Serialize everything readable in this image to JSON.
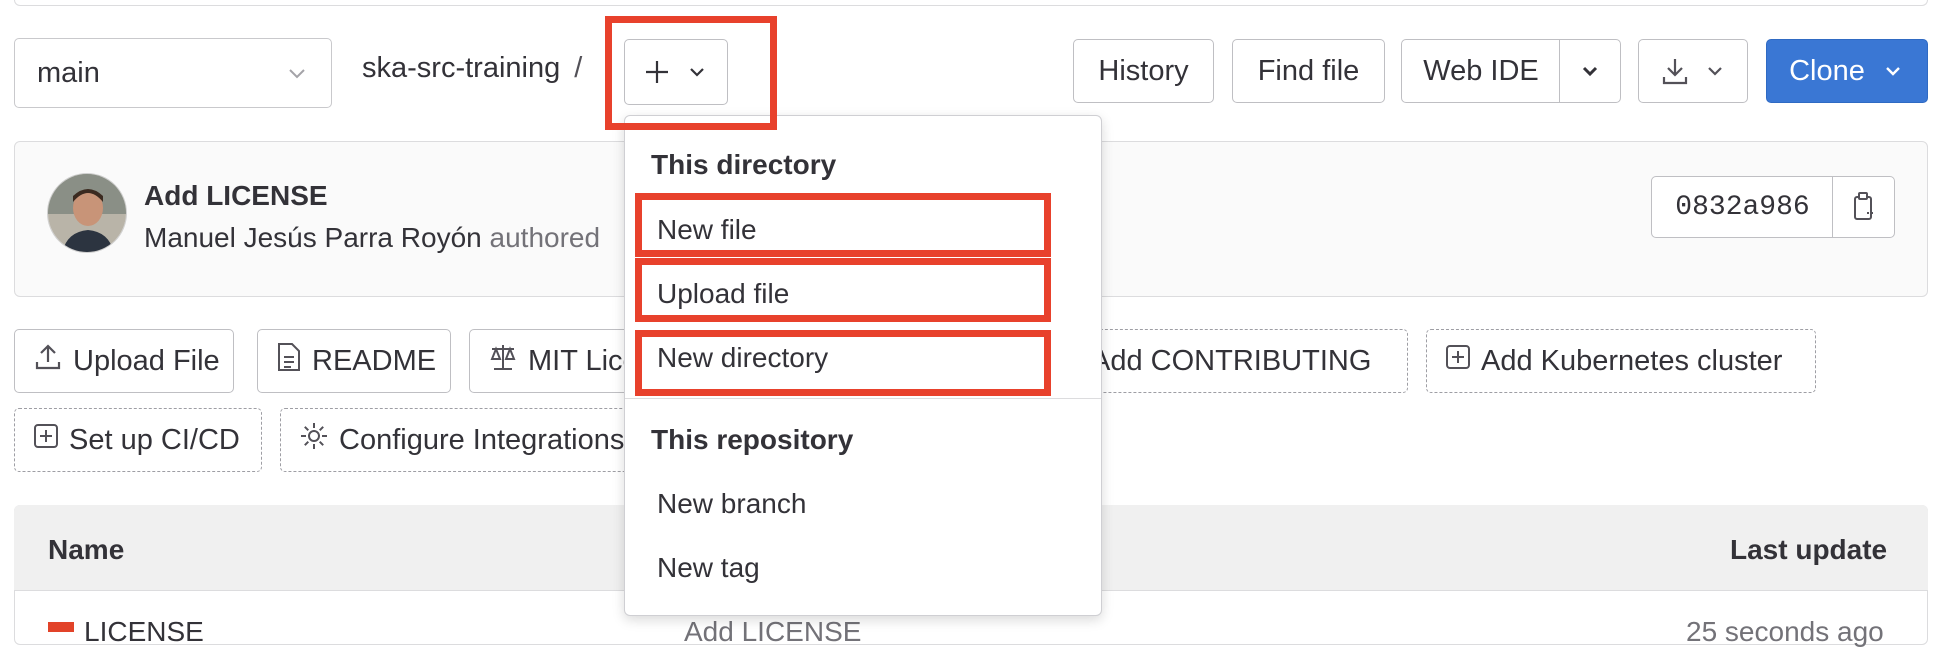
{
  "branch_selector": {
    "value": "main"
  },
  "breadcrumb": {
    "project": "ska-src-training",
    "separator": "/"
  },
  "toolbar": {
    "history_label": "History",
    "find_file_label": "Find file",
    "web_ide_label": "Web IDE",
    "clone_label": "Clone"
  },
  "last_commit": {
    "title": "Add LICENSE",
    "author": "Manuel Jesús Parra Royón",
    "authored_text": "authored",
    "sha": "0832a986"
  },
  "quick_actions": {
    "upload_file": "Upload File",
    "readme": "README",
    "mit_license": "MIT License",
    "add_contributing": "Add CONTRIBUTING",
    "add_kubernetes": "Add Kubernetes cluster",
    "setup_cicd": "Set up CI/CD",
    "configure_integrations": "Configure Integrations"
  },
  "add_dropdown": {
    "section_directory": "This directory",
    "new_file": "New file",
    "upload_file": "Upload file",
    "new_directory": "New directory",
    "section_repository": "This repository",
    "new_branch": "New branch",
    "new_tag": "New tag"
  },
  "file_table": {
    "col_name": "Name",
    "col_last_update": "Last update",
    "rows": [
      {
        "name": "LICENSE",
        "commit": "Add LICENSE",
        "updated": "25 seconds ago"
      }
    ]
  },
  "colors": {
    "accent": "#3a77d4",
    "highlight": "#e8412c"
  },
  "icons": [
    "chevron-down-icon",
    "plus-icon",
    "download-icon",
    "copy-icon",
    "upload-icon",
    "file-icon",
    "scale-icon",
    "plus-square-icon",
    "gear-icon"
  ]
}
